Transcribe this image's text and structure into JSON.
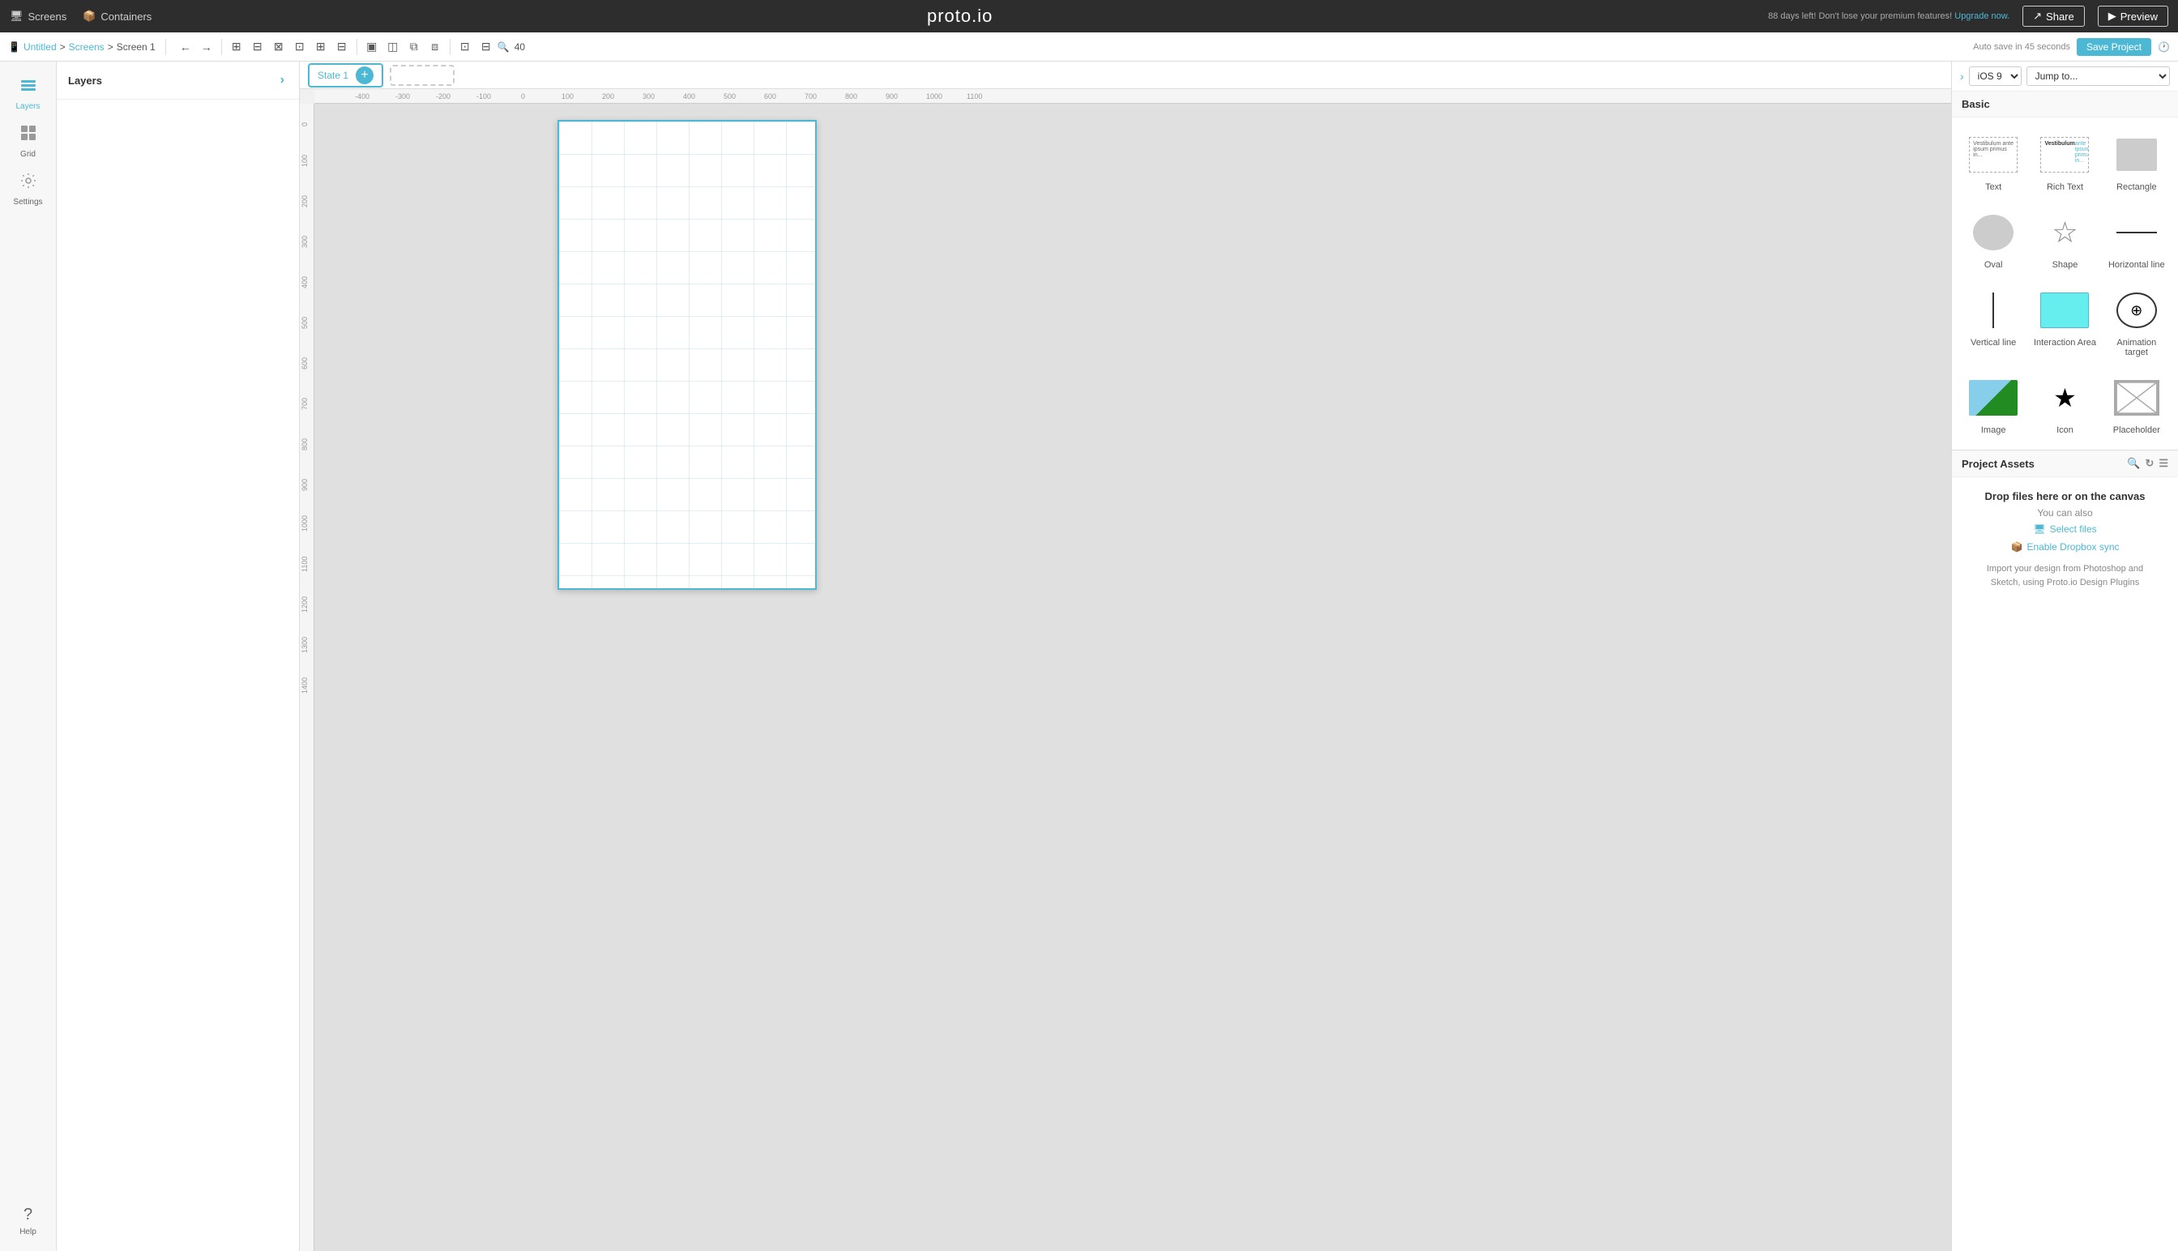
{
  "topNav": {
    "screens_label": "Screens",
    "containers_label": "Containers",
    "logo": "proto.io",
    "premium_msg": "88 days left! Don't lose your premium features!",
    "upgrade_link": "Upgrade now.",
    "share_label": "Share",
    "preview_label": "Preview"
  },
  "secondBar": {
    "breadcrumb": [
      "Untitled",
      "Screens",
      "Screen 1"
    ],
    "autosave_text": "Auto save in 45 seconds",
    "save_label": "Save Project",
    "zoom": "40"
  },
  "leftSidebar": {
    "items": [
      {
        "id": "layers",
        "label": "Layers",
        "icon": "☰",
        "active": true
      },
      {
        "id": "grid",
        "label": "Grid",
        "active": false
      },
      {
        "id": "settings",
        "label": "Settings",
        "active": false
      }
    ],
    "help_label": "Help"
  },
  "stateTab": {
    "label": "State 1"
  },
  "rightPanel": {
    "platform": "iOS 9",
    "jump_to": "Jump to...",
    "basic_section": "Basic",
    "widgets": [
      {
        "id": "text",
        "label": "Text",
        "type": "text"
      },
      {
        "id": "rich-text",
        "label": "Rich Text",
        "type": "richtext"
      },
      {
        "id": "rectangle",
        "label": "Rectangle",
        "type": "rect"
      },
      {
        "id": "oval",
        "label": "Oval",
        "type": "oval"
      },
      {
        "id": "shape",
        "label": "Shape",
        "type": "star"
      },
      {
        "id": "horizontal-line",
        "label": "Horizontal line",
        "type": "hline"
      },
      {
        "id": "vertical-line",
        "label": "Vertical line",
        "type": "vline"
      },
      {
        "id": "interaction-area",
        "label": "Interaction Area",
        "type": "interaction"
      },
      {
        "id": "animation-target",
        "label": "Animation target",
        "type": "animation"
      },
      {
        "id": "image",
        "label": "Image",
        "type": "image"
      },
      {
        "id": "icon",
        "label": "Icon",
        "type": "icon"
      },
      {
        "id": "placeholder",
        "label": "Placeholder",
        "type": "placeholder"
      }
    ]
  },
  "projectAssets": {
    "title": "Project Assets",
    "drop_text": "Drop files here or on the canvas",
    "you_can": "You can also",
    "select_files_label": "Select files",
    "dropbox_label": "Enable Dropbox sync",
    "note": "Import your design from Photoshop and\nSketch, using Proto.io Design Plugins"
  },
  "rulers": {
    "h_ticks": [
      "-400",
      "-300",
      "-200",
      "-100",
      "0",
      "100",
      "200",
      "300",
      "400",
      "500",
      "600",
      "700",
      "800",
      "900",
      "1000",
      "1100"
    ],
    "v_ticks": [
      "0",
      "100",
      "200",
      "300",
      "400",
      "500",
      "600",
      "700",
      "800",
      "900",
      "1000",
      "1100",
      "1200",
      "1300",
      "1400"
    ]
  }
}
